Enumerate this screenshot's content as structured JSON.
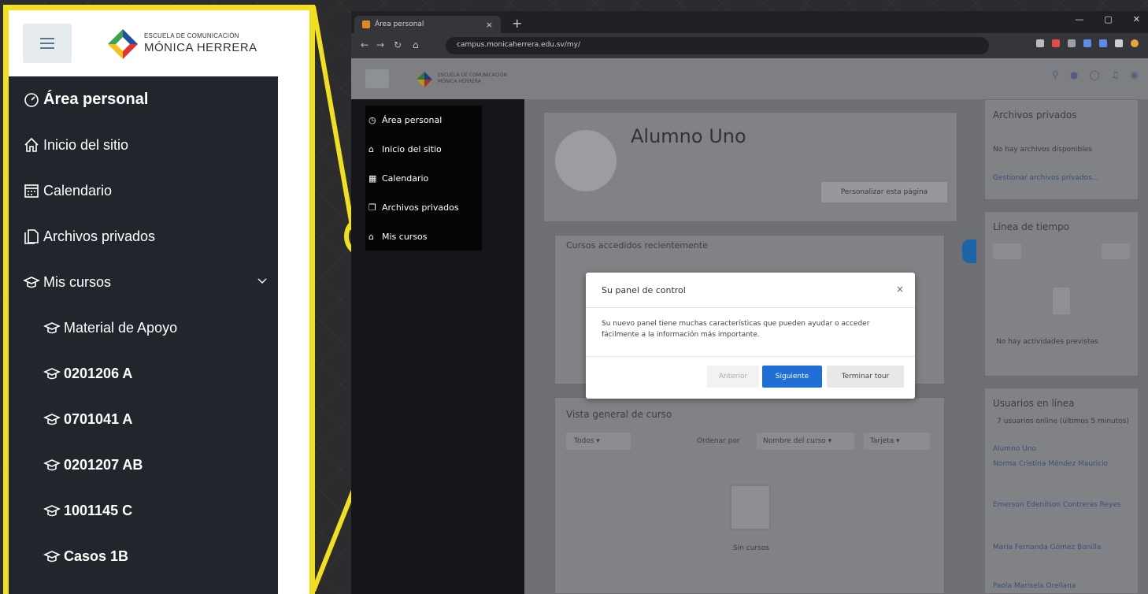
{
  "zoom_panel": {
    "logo_line1": "ESCUELA DE COMUNICACIÓN",
    "logo_line2": "MÓNICA HERRERA",
    "nav": [
      {
        "label": "Área personal",
        "icon": "dashboard-icon"
      },
      {
        "label": "Inicio del sitio",
        "icon": "home-icon"
      },
      {
        "label": "Calendario",
        "icon": "calendar-icon"
      },
      {
        "label": "Archivos privados",
        "icon": "files-icon"
      },
      {
        "label": "Mis cursos",
        "icon": "graduation-cap-icon"
      }
    ],
    "courses": [
      "Material de Apoyo",
      "0201206 A",
      "0701041 A",
      "0201207 AB",
      "1001145 C",
      "Casos 1B"
    ]
  },
  "browser": {
    "tab_title": "Área personal",
    "url": "campus.monicaherrera.edu.sv/my/"
  },
  "moodle": {
    "logo_line1": "ESCUELA DE COMUNICACIÓN",
    "logo_line2": "MÓNICA HERRERA",
    "drawer": [
      "Área personal",
      "Inicio del sitio",
      "Calendario",
      "Archivos privados",
      "Mis cursos"
    ],
    "user_name": "Alumno Uno",
    "customize_button": "Personalizar esta página",
    "recent_courses_title": "Cursos accedidos recientemente",
    "overview_title": "Vista general de curso",
    "filter_all": "Todos",
    "sort_label": "Ordenar por",
    "sort_value": "Nombre del curso",
    "view_value": "Tarjeta",
    "no_courses": "Sin cursos",
    "right": {
      "private_files_title": "Archivos privados",
      "no_files": "No hay archivos disponibles",
      "manage_files": "Gestionar archivos privados...",
      "timeline_title": "Línea de tiempo",
      "no_activities": "No hay actividades previstas",
      "online_users_title": "Usuarios en línea",
      "online_summary": "7 usuarios online (últimos 5 minutos)",
      "users": [
        "Alumno Uno",
        "Norma Cristina Méndez Mauricio",
        "Emerson Edenilson Contreras Reyes",
        "María Fernanda Gómez Bonilla",
        "Paola Marisela Orellana"
      ]
    }
  },
  "modal": {
    "title": "Su panel de control",
    "close": "×",
    "body": "Su nuevo panel tiene muchas características que pueden ayudar o acceder fácilmente a la información más importante.",
    "prev": "Anterior",
    "next": "Siguiente",
    "end": "Terminar tour"
  },
  "colors": {
    "highlight": "#f1e01e",
    "drawer_bg": "#22262c",
    "primary_button": "#1f6fd6"
  }
}
